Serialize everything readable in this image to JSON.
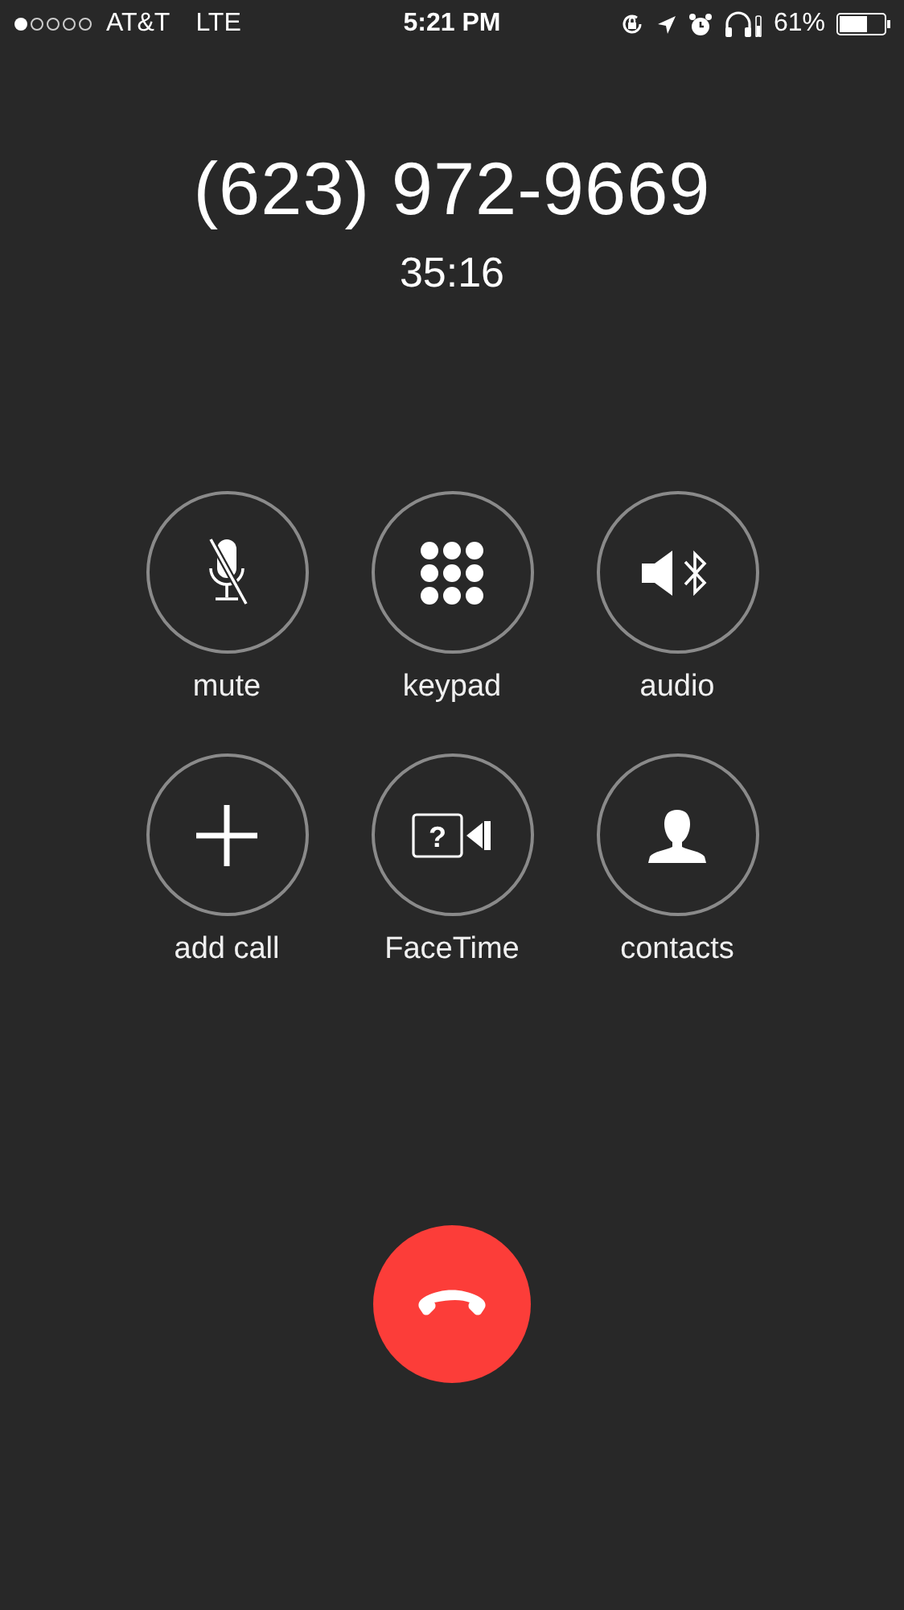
{
  "status_bar": {
    "carrier": "AT&T",
    "network": "LTE",
    "time": "5:21 PM",
    "battery_percent": "61%"
  },
  "call": {
    "number": "(623) 972-9669",
    "duration": "35:16"
  },
  "buttons": [
    {
      "kind": "mute",
      "label": "mute"
    },
    {
      "kind": "keypad",
      "label": "keypad"
    },
    {
      "kind": "audio",
      "label": "audio"
    },
    {
      "kind": "add",
      "label": "add call"
    },
    {
      "kind": "facetime",
      "label": "FaceTime",
      "glyph": "?"
    },
    {
      "kind": "contacts",
      "label": "contacts"
    }
  ]
}
